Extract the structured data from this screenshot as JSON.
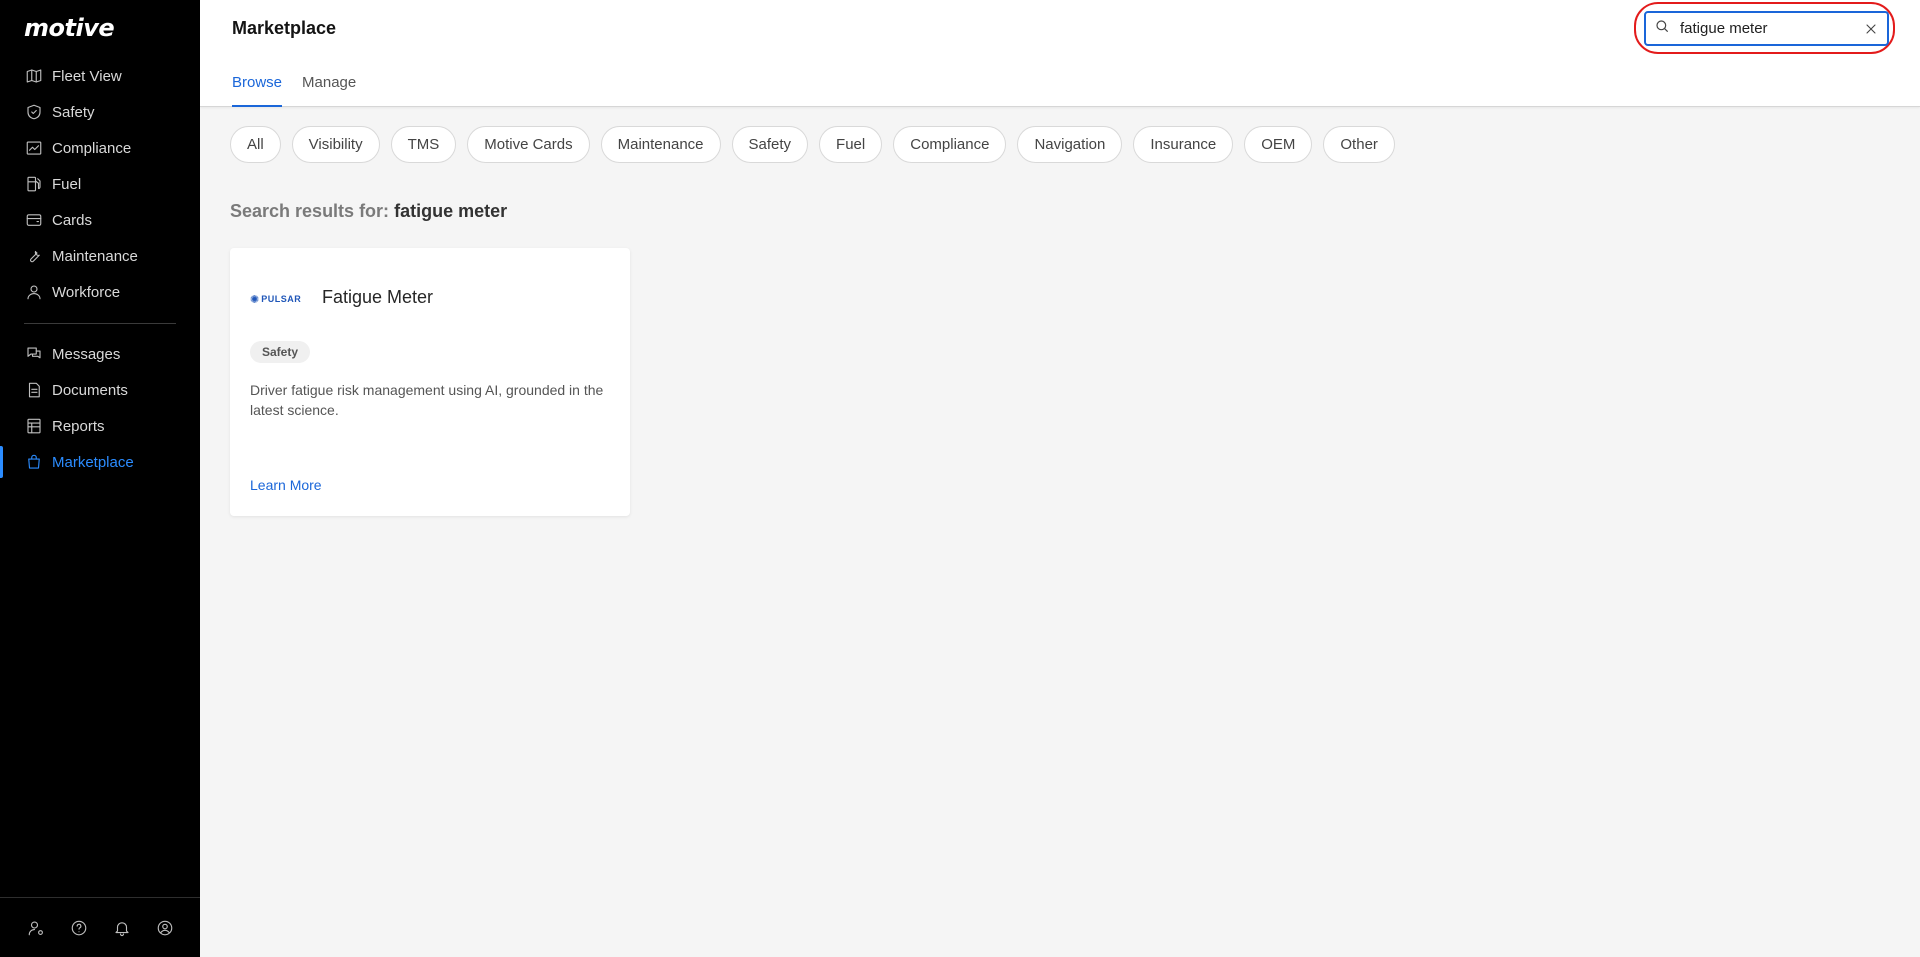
{
  "brand": {
    "logo_text": "motive"
  },
  "sidebar": {
    "items": [
      {
        "label": "Fleet View",
        "icon": "map-icon"
      },
      {
        "label": "Safety",
        "icon": "shield-icon"
      },
      {
        "label": "Compliance",
        "icon": "chart-icon"
      },
      {
        "label": "Fuel",
        "icon": "fuel-pump-icon"
      },
      {
        "label": "Cards",
        "icon": "wallet-icon"
      },
      {
        "label": "Maintenance",
        "icon": "wrench-icon"
      },
      {
        "label": "Workforce",
        "icon": "person-icon"
      },
      {
        "label": "Messages",
        "icon": "chat-icon"
      },
      {
        "label": "Documents",
        "icon": "document-icon"
      },
      {
        "label": "Reports",
        "icon": "table-icon"
      },
      {
        "label": "Marketplace",
        "icon": "shopping-bag-icon",
        "active": true
      }
    ],
    "footer_icons": [
      "user-settings-icon",
      "help-icon",
      "bell-icon",
      "account-icon"
    ],
    "accent_color": "#2b8cff"
  },
  "header": {
    "title": "Marketplace",
    "tabs": [
      {
        "label": "Browse",
        "active": true
      },
      {
        "label": "Manage",
        "active": false
      }
    ],
    "search": {
      "value": "fatigue meter",
      "placeholder": "Search"
    }
  },
  "filters": [
    "All",
    "Visibility",
    "TMS",
    "Motive Cards",
    "Maintenance",
    "Safety",
    "Fuel",
    "Compliance",
    "Navigation",
    "Insurance",
    "OEM",
    "Other"
  ],
  "results": {
    "prefix": "Search results for:",
    "query": "fatigue meter",
    "cards": [
      {
        "logo_text": "PULSAR",
        "title": "Fatigue Meter",
        "category": "Safety",
        "description": "Driver fatigue risk management using AI, grounded in the latest science.",
        "link_label": "Learn More"
      }
    ]
  },
  "colors": {
    "link_blue": "#1a66d9",
    "highlight_ring": "#e31b1b"
  }
}
